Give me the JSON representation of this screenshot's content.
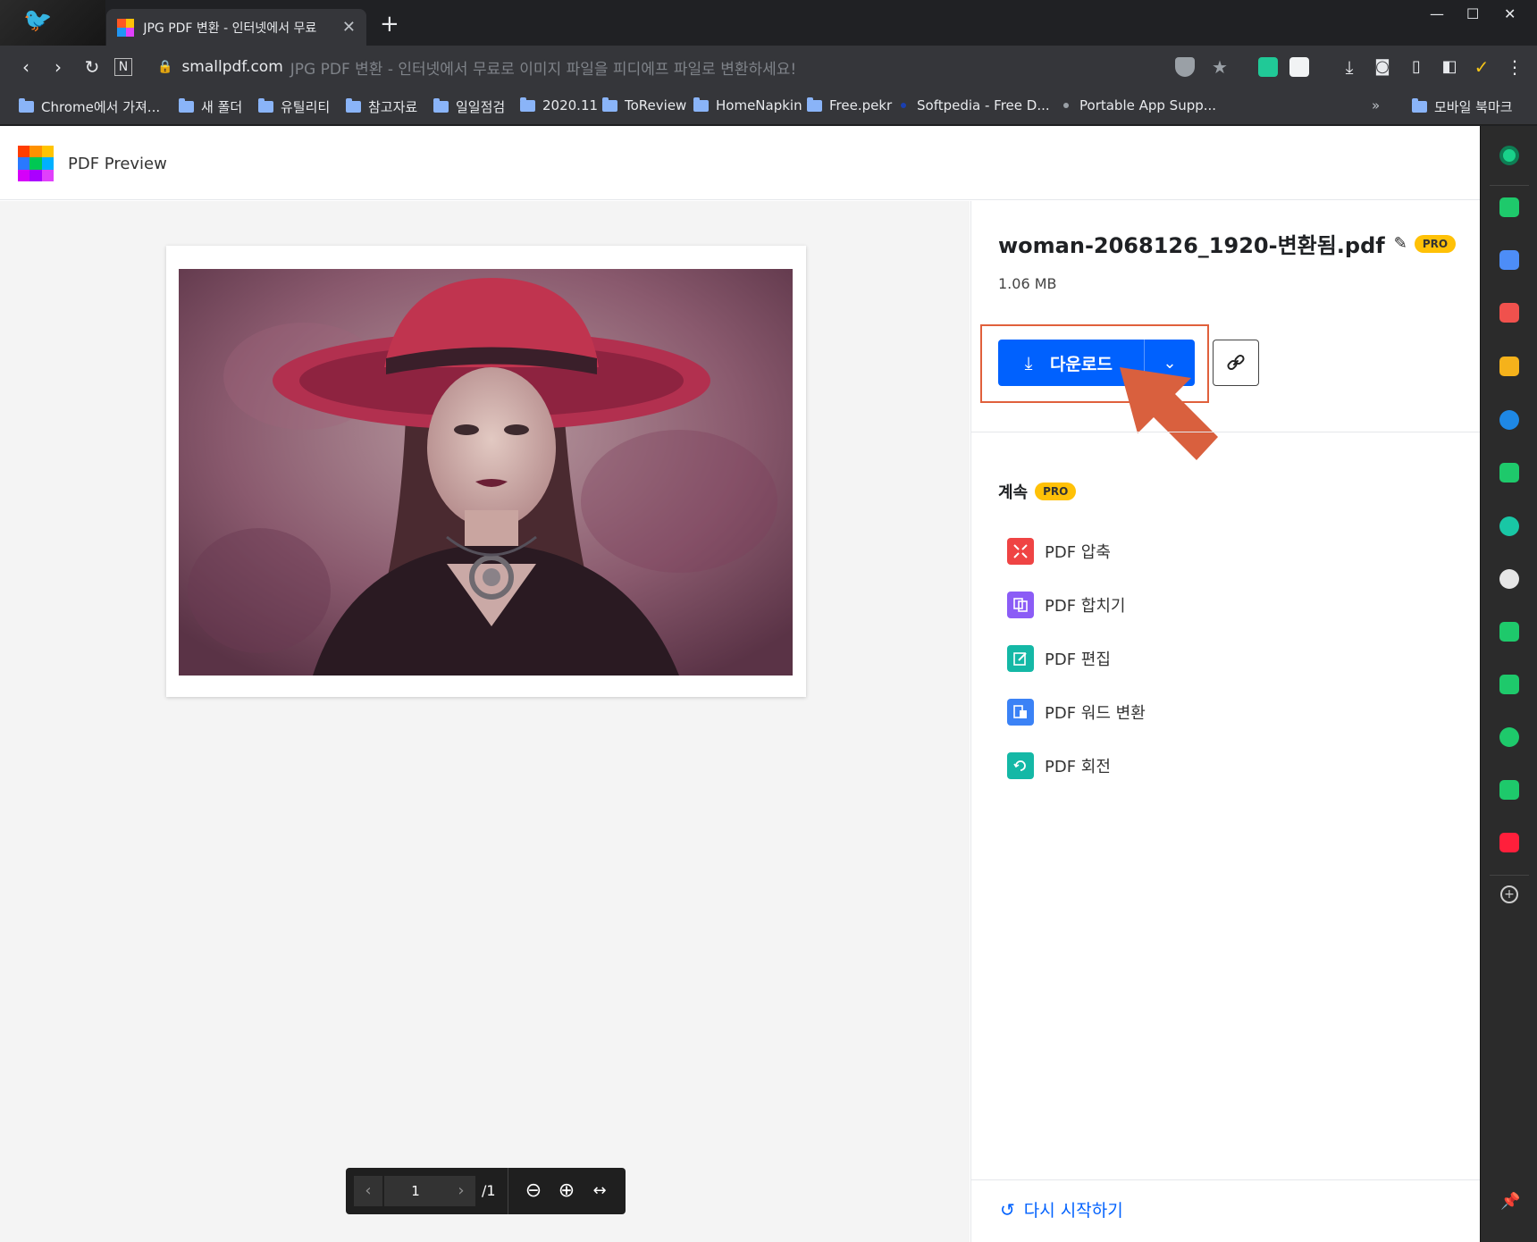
{
  "browser": {
    "tab_title": "JPG PDF 변환 - 인터넷에서 무료",
    "new_tab": "+",
    "url_domain": "smallpdf.com",
    "url_rest": "JPG PDF 변환 - 인터넷에서 무료로 이미지 파일을 피디에프 파일로 변환하세요!"
  },
  "bookmarks": [
    {
      "label": "Chrome에서 가져..."
    },
    {
      "label": "새 폴더"
    },
    {
      "label": "유틸리티"
    },
    {
      "label": "참고자료"
    },
    {
      "label": "일일점검"
    },
    {
      "label": "2020.11"
    },
    {
      "label": "ToReview"
    },
    {
      "label": "HomeNapkin"
    },
    {
      "label": "Free.pekr"
    },
    {
      "label": "Softpedia - Free D..."
    },
    {
      "label": "Portable App Supp..."
    }
  ],
  "bookmarks_overflow": "»",
  "mobile_bookmarks": "모바일 북마크",
  "header": {
    "title": "PDF Preview"
  },
  "file": {
    "name": "woman-2068126_1920-변환됨.pdf",
    "size": "1.06 MB",
    "pro_badge": "PRO"
  },
  "actions": {
    "download_label": "다운로드"
  },
  "continue": {
    "title": "계속",
    "pro_badge": "PRO",
    "tools": [
      {
        "label": "PDF 압축",
        "color": "#ef4444"
      },
      {
        "label": "PDF 합치기",
        "color": "#8b5cf6"
      },
      {
        "label": "PDF 편집",
        "color": "#14b8a6"
      },
      {
        "label": "PDF 워드 변환",
        "color": "#3b82f6"
      },
      {
        "label": "PDF 회전",
        "color": "#14b8a6"
      }
    ]
  },
  "restart_label": "다시 시작하기",
  "pager": {
    "current_page": "1",
    "total": "/1"
  },
  "colors": {
    "accent": "#0061fe",
    "pro": "#ffc107",
    "highlight": "#e0603c"
  }
}
